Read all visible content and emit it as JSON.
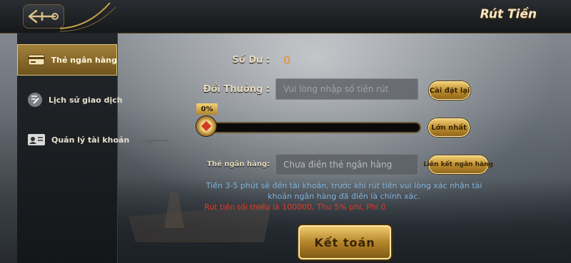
{
  "header": {
    "title": "Rút Tiền"
  },
  "sidebar": {
    "items": [
      {
        "label": "Thẻ ngân hàng",
        "icon": "bank-card-icon",
        "active": true
      },
      {
        "label": "Lịch sử giao dịch",
        "icon": "history-icon",
        "active": false
      },
      {
        "label": "Quản lý tài khoản",
        "icon": "id-card-icon",
        "active": false
      }
    ]
  },
  "form": {
    "balance_label": "Số Dư :",
    "balance_value": "0",
    "exchange_label": "Đổi Thưởng :",
    "amount_placeholder": "Vui lòng nhập số tiền rút",
    "reset_label": "Cài đặt lại",
    "slider_percent": "0%",
    "max_label": "Lớn nhất",
    "bank_label": "Thẻ ngân hàng:",
    "bank_value": "Chưa điền thẻ ngân hàng",
    "link_bank_label": "Liên kết ngân hàng",
    "note_line1": "Tiền 3-5 phút sẽ đến tài khoản, trước khi rút tiền vui lòng xác nhận tài",
    "note_line2": "khoản ngân hàng đã điền là chính xác.",
    "warning": "Rút tiền tối thiểu là 100000, Thu 5% phí, Phí 0",
    "submit_label": "Kết toán"
  },
  "colors": {
    "accent_gold": "#c9a24a",
    "balance": "#f08b2b",
    "note": "#7fb1d8",
    "warning": "#e23a2a"
  }
}
